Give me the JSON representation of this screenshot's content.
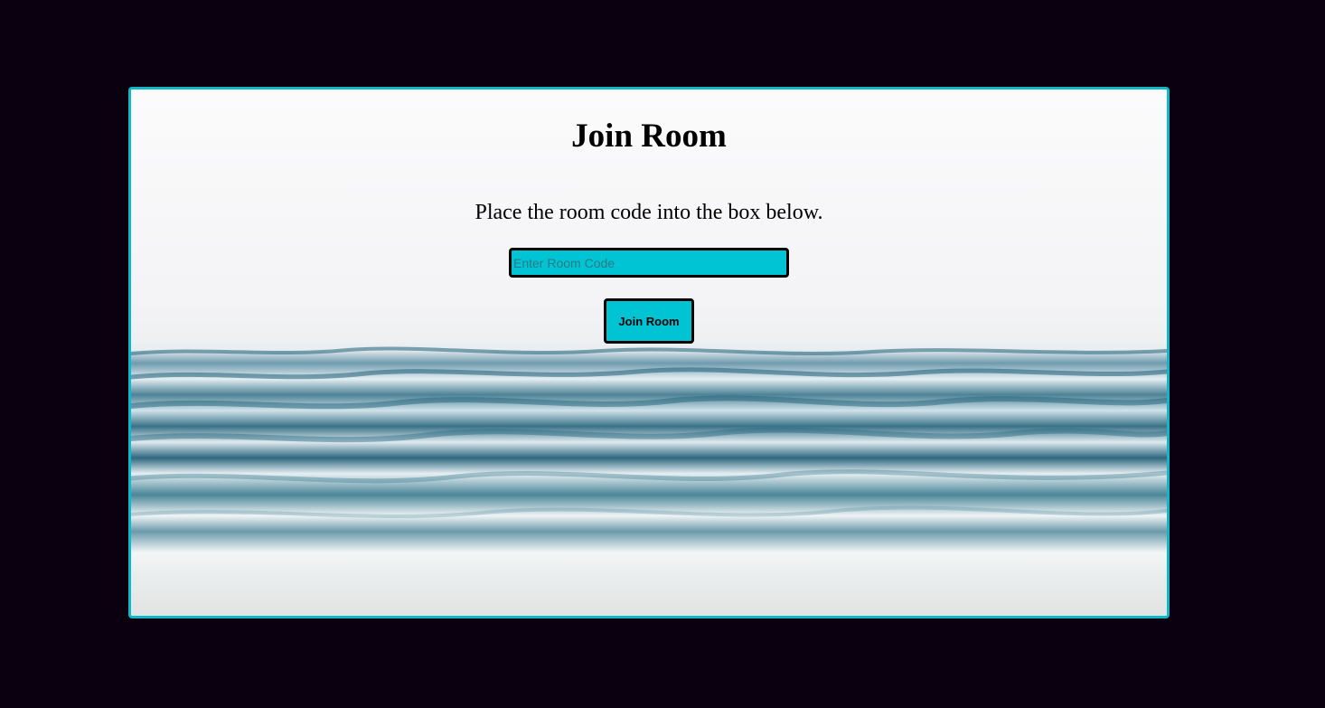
{
  "page": {
    "background_color": "#0b0010",
    "accent_color": "#00c3d4",
    "border_color": "#10b7c6"
  },
  "card": {
    "background_image": "ocean waves on beach",
    "title": "Join Room",
    "instructions": "Place the room code into the box below.",
    "room_code_input": {
      "value": "",
      "placeholder": "Enter Room Code"
    },
    "join_button_label": "Join Room"
  }
}
